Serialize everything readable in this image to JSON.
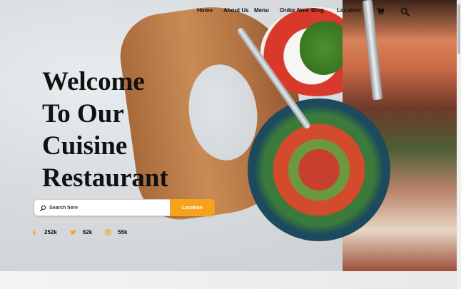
{
  "nav": {
    "items": [
      "Home",
      "About Us",
      "Menu",
      "Order Now",
      "Blog",
      "Location"
    ]
  },
  "icons": {
    "cart": "cart-icon",
    "search": "search-icon"
  },
  "hero": {
    "title_lines": [
      "Welcome",
      "To Our",
      "Cuisine",
      "Restaurant"
    ]
  },
  "search": {
    "placeholder": "Search here",
    "button_label": "Location"
  },
  "social": [
    {
      "icon": "facebook-icon",
      "count": "252k"
    },
    {
      "icon": "twitter-icon",
      "count": "62k"
    },
    {
      "icon": "instagram-icon",
      "count": "55k"
    }
  ],
  "colors": {
    "accent": "#f7a21b",
    "text": "#111111"
  }
}
